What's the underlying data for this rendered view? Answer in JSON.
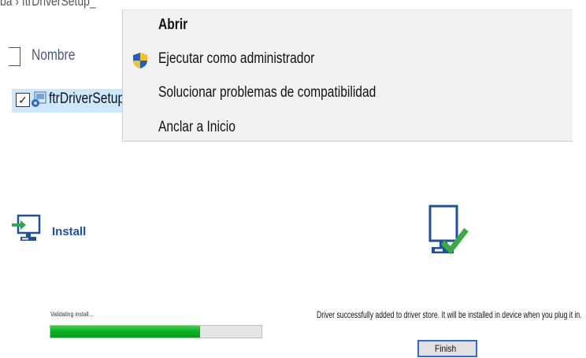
{
  "explorer": {
    "breadcrumb": "ba › ftrDriverSetup_",
    "column_header": "Nombre",
    "file_name": "ftrDriverSetup",
    "file_checked": true
  },
  "context_menu": {
    "items": [
      {
        "label": "Abrir",
        "bold": true
      },
      {
        "label": "Ejecutar como administrador",
        "icon": "uac-shield-icon"
      },
      {
        "label": "Solucionar problemas de compatibilidad"
      },
      {
        "label": "Anclar a Inicio"
      }
    ]
  },
  "installer": {
    "title": "Install",
    "status_text": "Validating install...",
    "progress": 0.71,
    "success_message": "Driver successfully added to driver store. It will be installed in device when you plug it in.",
    "finish_label": "Finish"
  },
  "colors": {
    "accent_blue": "#1e4fa3",
    "progress_green": "#06b025",
    "selection_blue": "#cce8ff",
    "check_green": "#3aa845"
  }
}
